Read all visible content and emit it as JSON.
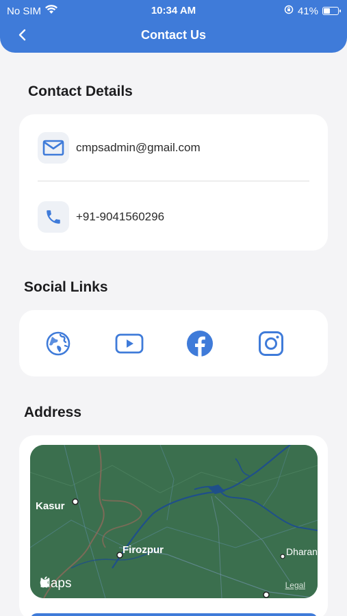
{
  "status_bar": {
    "carrier": "No SIM",
    "time": "10:34 AM",
    "battery": "41%",
    "battery_level": 0.41
  },
  "header": {
    "title": "Contact Us"
  },
  "contact": {
    "title": "Contact Details",
    "email": "cmpsadmin@gmail.com",
    "phone": "+91-9041560296"
  },
  "social": {
    "title": "Social Links",
    "icons": [
      "globe-icon",
      "youtube-icon",
      "facebook-icon",
      "instagram-icon"
    ]
  },
  "address": {
    "title": "Address",
    "map_labels": {
      "kasur": "Kasur",
      "firozpur": "Firozpur",
      "dharan": "Dharan"
    },
    "maps_brand": "Maps",
    "legal": "Legal"
  },
  "colors": {
    "accent": "#3f7bd9",
    "map_green": "#3b6f4e",
    "background": "#f4f4f6"
  }
}
